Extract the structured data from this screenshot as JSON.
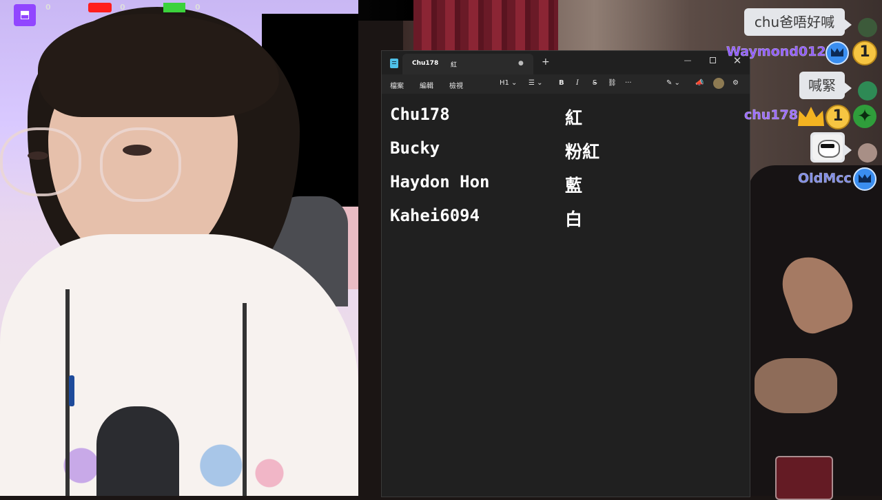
{
  "stream_overlay": {
    "platform_icons": [
      "twitch-icon",
      "youtube-icon",
      "kick-icon"
    ],
    "counts": [
      "0",
      "0",
      "0"
    ]
  },
  "notepad": {
    "tabs": [
      {
        "label": "Chu178",
        "secondary_label": "紅",
        "modified_marker": "●"
      }
    ],
    "new_tab": "+",
    "window_controls": {
      "minimize": "—",
      "maximize": "",
      "close": "✕"
    },
    "menu": [
      "檔案",
      "編輯",
      "檢視"
    ],
    "toolbar": {
      "heading": "H1 ⌄",
      "list": "☰ ⌄",
      "bold": "B",
      "italic": "I",
      "strike": "S",
      "link": "⛓",
      "more": "···",
      "ai": "✎ ⌄",
      "announce": "📣",
      "settings": "⚙"
    },
    "rows": [
      {
        "name": "Chu178",
        "color": "紅"
      },
      {
        "name": "Bucky",
        "color": "粉紅"
      },
      {
        "name": "Haydon Hon",
        "color": "藍"
      },
      {
        "name": "Kahei6094",
        "color": "白"
      }
    ]
  },
  "chat": {
    "messages": [
      {
        "text": "chu爸唔好喊",
        "user": "Waymond01234"
      },
      {
        "text": "喊緊",
        "user": "chu178"
      },
      {
        "text": "",
        "user": "OldMcc"
      }
    ],
    "colors": {
      "waymond": "#8f5bff",
      "chu178": "#9a6bff",
      "oldmcc": "#7f8ce6"
    }
  }
}
